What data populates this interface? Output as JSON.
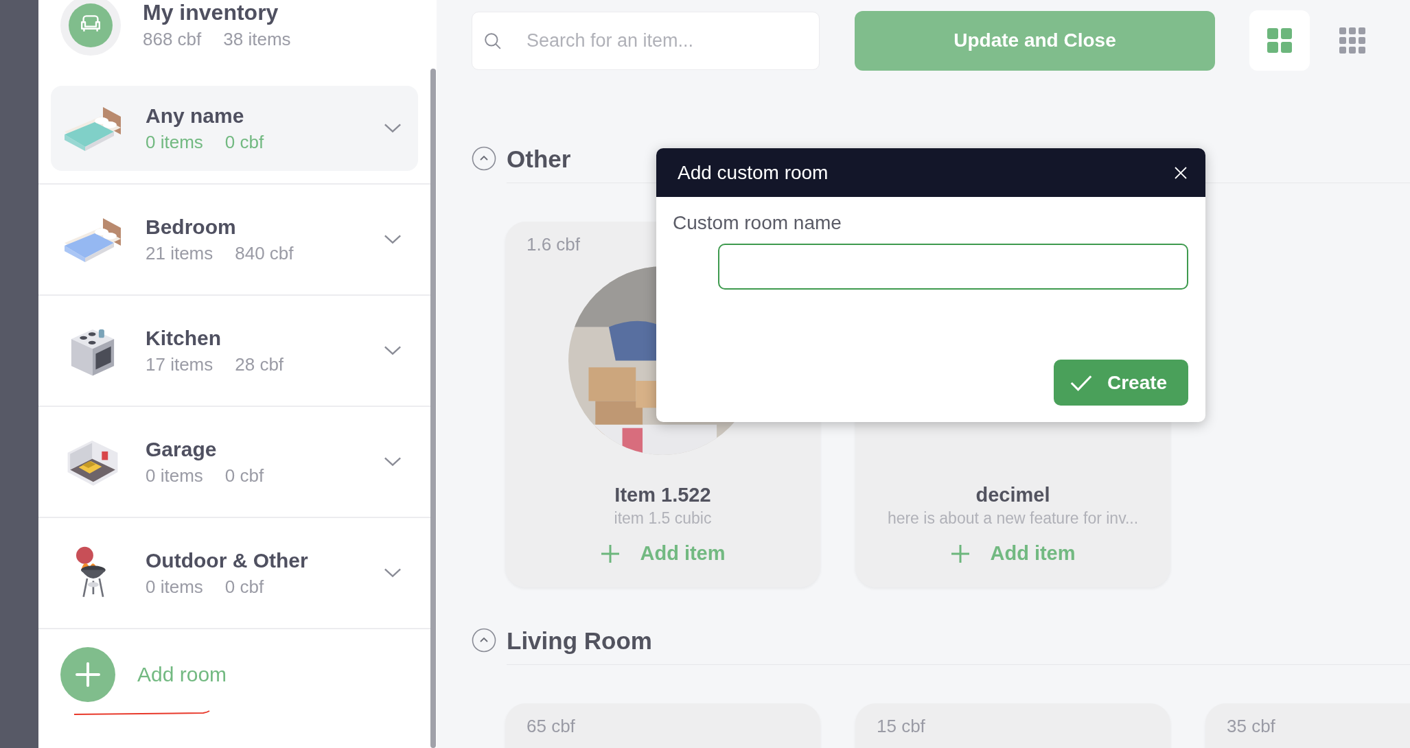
{
  "sidebar": {
    "header": {
      "title": "My inventory",
      "volume": "868 cbf",
      "count": "38 items"
    },
    "rooms": [
      {
        "name": "Any name",
        "items": "0 items",
        "volume": "0 cbf",
        "selected": true,
        "kind": "bed",
        "color": "#80d0c8"
      },
      {
        "name": "Bedroom",
        "items": "21 items",
        "volume": "840 cbf",
        "selected": false,
        "kind": "bed",
        "color": "#95b8f2"
      },
      {
        "name": "Kitchen",
        "items": "17 items",
        "volume": "28 cbf",
        "selected": false,
        "kind": "stove"
      },
      {
        "name": "Garage",
        "items": "0 items",
        "volume": "0 cbf",
        "selected": false,
        "kind": "garage"
      },
      {
        "name": "Outdoor & Other",
        "items": "0 items",
        "volume": "0 cbf",
        "selected": false,
        "kind": "grill"
      }
    ],
    "add_room": "Add room"
  },
  "toolbar": {
    "search": {
      "placeholder": "Search for an item..."
    },
    "update_button": "Update and Close",
    "views": [
      {
        "kind": "large",
        "selected": true
      },
      {
        "kind": "small",
        "selected": false
      }
    ]
  },
  "sections": [
    {
      "title": "Other",
      "expanded": true,
      "cards": [
        {
          "volume": "1.6 cbf",
          "title": "Item 1.522",
          "subtitle": "item 1.5 cubic",
          "add_label": "Add item",
          "kind": "picture"
        },
        {
          "title": "decimel",
          "subtitle": "here is about a new feature for inv...",
          "add_label": "Add item"
        }
      ]
    },
    {
      "title": "Living Room",
      "expanded": true,
      "cards": [
        {
          "volume": "65 cbf"
        },
        {
          "volume": "15 cbf"
        },
        {
          "volume": "35 cbf"
        }
      ]
    }
  ],
  "dialog": {
    "title": "Add custom room",
    "label": "Custom room name",
    "button": "Create"
  }
}
